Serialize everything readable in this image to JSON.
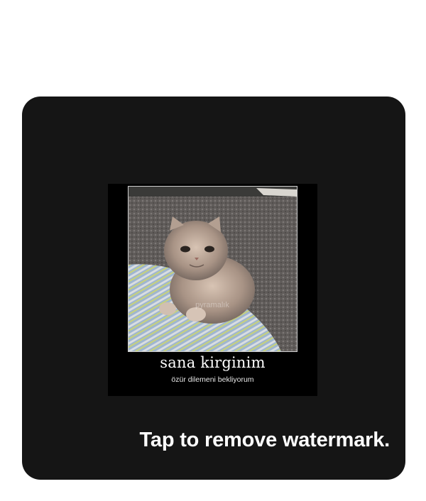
{
  "watermark_prompt": {
    "tap_text": "Tap to remove watermark."
  },
  "meme": {
    "title": "sana kirginim",
    "subtitle": "özür dilemeni bekliyorum",
    "image_subject": "kitten-on-rug",
    "image_watermark": "pyramalık"
  },
  "colors": {
    "page_background": "#ffffff",
    "card_background": "#151515",
    "meme_background": "#000000",
    "text": "#ffffff"
  }
}
